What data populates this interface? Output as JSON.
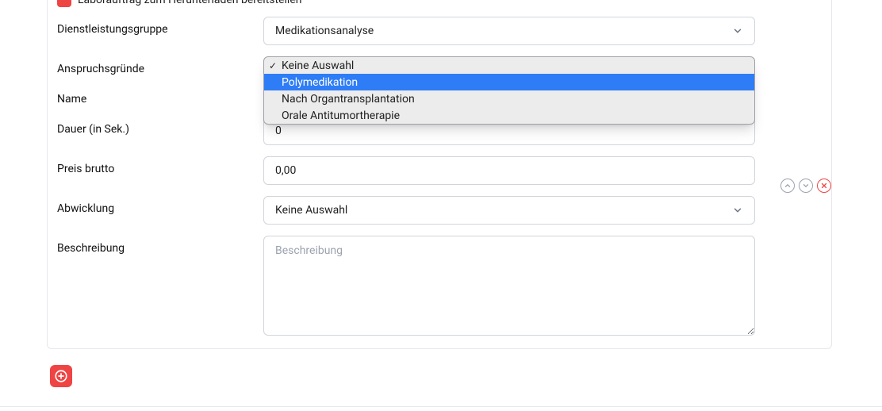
{
  "header": {
    "cutoff_text": "Laborauftrag zum Herunterladen bereitstellen"
  },
  "form": {
    "dienstleistungsgruppe": {
      "label": "Dienstleistungsgruppe",
      "value": "Medikationsanalyse"
    },
    "anspruchsgruende": {
      "label": "Anspruchsgründe",
      "selected": "Keine Auswahl",
      "options": [
        "Keine Auswahl",
        "Polymedikation",
        "Nach Organtransplantation",
        "Orale Antitumortherapie"
      ],
      "highlighted_index": 1
    },
    "name": {
      "label": "Name",
      "value": ""
    },
    "dauer": {
      "label": "Dauer (in Sek.)",
      "value": "0"
    },
    "preis": {
      "label": "Preis brutto",
      "value": "0,00"
    },
    "abwicklung": {
      "label": "Abwicklung",
      "value": "Keine Auswahl"
    },
    "beschreibung": {
      "label": "Beschreibung",
      "placeholder": "Beschreibung",
      "value": ""
    }
  },
  "icons": {
    "chevron_down": "chevron-down-icon",
    "move_up": "move-up-icon",
    "move_down": "move-down-icon",
    "remove": "remove-icon",
    "add": "add-icon",
    "check": "check-icon"
  }
}
